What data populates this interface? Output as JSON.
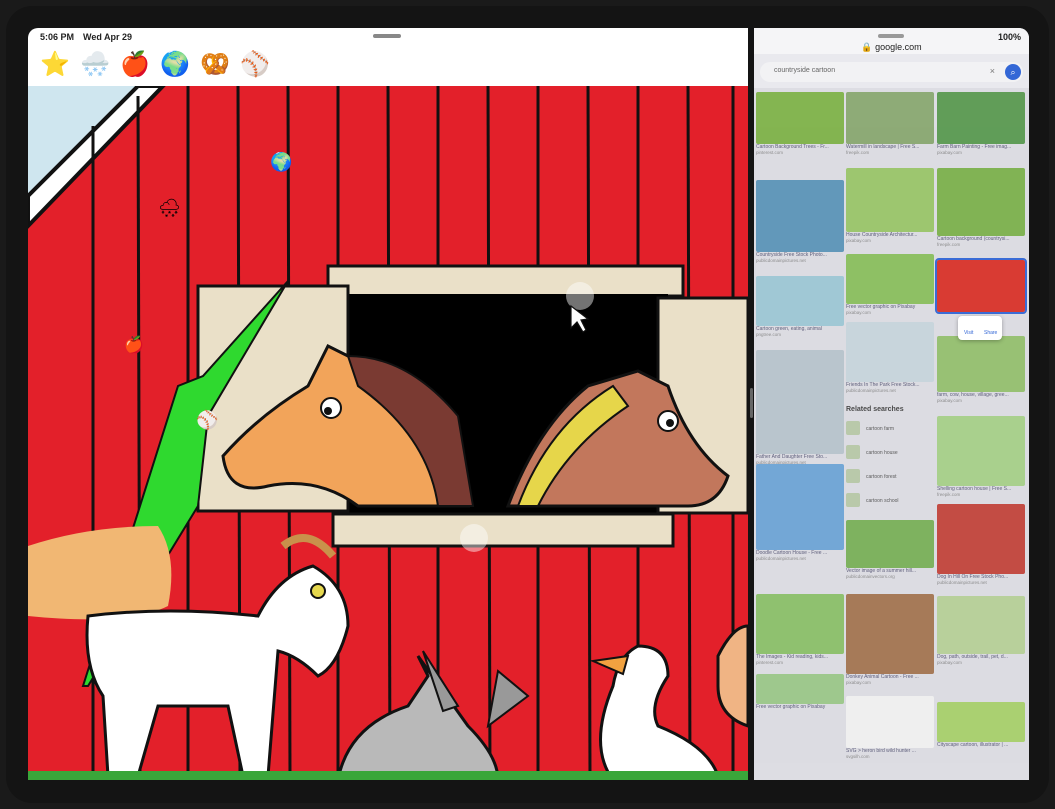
{
  "status": {
    "time": "5:06 PM",
    "date": "Wed Apr 29",
    "battery": "100%"
  },
  "toolbar": {
    "emojis": [
      {
        "name": "star",
        "glyph": "⭐"
      },
      {
        "name": "snow-cloud",
        "glyph": "🌨️"
      },
      {
        "name": "apple",
        "glyph": "🍎"
      },
      {
        "name": "globe",
        "glyph": "🌍"
      },
      {
        "name": "pretzel",
        "glyph": "🥨"
      },
      {
        "name": "baseball",
        "glyph": "⚾"
      }
    ]
  },
  "browser": {
    "url": "google.com",
    "query": "countryside cartoon",
    "clear": "×",
    "results": [
      {
        "caption": "Cartoon Background Trees - Fr...",
        "source": "pinterest.com"
      },
      {
        "caption": "Watermill in landscape | Free S...",
        "source": "freepik.com"
      },
      {
        "caption": "Farm Barn Painting - Free imag...",
        "source": "pixabay.com"
      },
      {
        "caption": "Countryside Free Stock Photo...",
        "source": "publicdomainpictures.net"
      },
      {
        "caption": "House Countryside Architectur...",
        "source": "pixabay.com"
      },
      {
        "caption": "Cartoon background (countrysi...",
        "source": "freepik.com"
      },
      {
        "caption": "Cartoon green, eating, animal",
        "source": "pngtree.com"
      },
      {
        "caption": "Free vector graphic on Pixabay",
        "source": "pixabay.com"
      },
      {
        "caption": "Father And Daughter Free Sto...",
        "source": "publicdomainpictures.net"
      },
      {
        "caption": "Friends In The Park Free Stock...",
        "source": "publicdomainpictures.net"
      },
      {
        "caption": "farm, cow, house, village, gree...",
        "source": "pixabay.com"
      },
      {
        "caption": "Doodle Cartoon House - Free ...",
        "source": "publicdomainpictures.net"
      },
      {
        "caption": "Shelling cartoon house | Free S...",
        "source": "freepik.com"
      },
      {
        "caption": "Vector image of a summer hill...",
        "source": "publicdomainvectors.org"
      },
      {
        "caption": "Dog In Hill On Free Stock Pho...",
        "source": "publicdomainpictures.net"
      },
      {
        "caption": "The Images - Kid reading, kids...",
        "source": "pinterest.com"
      },
      {
        "caption": "Donkey Animal Cartoon - Free ...",
        "source": "pixabay.com"
      },
      {
        "caption": "Dog, path, outside, trail, pet, d...",
        "source": "pixabay.com"
      },
      {
        "caption": "Free vector graphic on Pixabay",
        "source": "pixabay.com"
      },
      {
        "caption": "SVG > heron bird wild hunter ...",
        "source": "svgsilh.com"
      },
      {
        "caption": "Cityscape cartoon, illustrator | ...",
        "source": "freepik.com"
      }
    ],
    "related_title": "Related searches",
    "related": [
      "cartoon farm",
      "cartoon house",
      "cartoon forest",
      "cartoon school"
    ],
    "popup": {
      "visit": "Visit",
      "share": "Share"
    }
  },
  "colors": {
    "barn_red": "#e3202a",
    "accent_blue": "#3367d6"
  }
}
